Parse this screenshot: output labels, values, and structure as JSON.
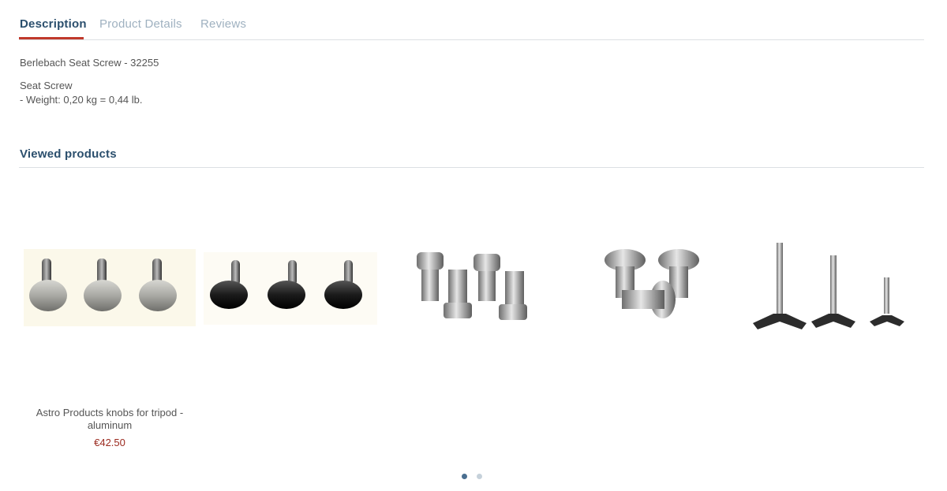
{
  "tabs": [
    {
      "label": "Description",
      "active": true
    },
    {
      "label": "Product Details",
      "active": false
    },
    {
      "label": "Reviews",
      "active": false
    }
  ],
  "description": {
    "title_line": "Berlebach Seat Screw - 32255",
    "line1": "Seat Screw",
    "line2": "- Weight: 0,20 kg = 0,44 lb."
  },
  "viewed": {
    "title": "Viewed products",
    "products": [
      {
        "name": "Astro Products knobs for tripod - aluminum",
        "price": "€42.50",
        "image": "aluminum-and-black-knob-screws"
      },
      {
        "image": "hex-socket-screws"
      },
      {
        "image": "button-head-screws"
      },
      {
        "image": "wing-knob-screws"
      }
    ],
    "pagination": {
      "pages": 2,
      "current": 1
    }
  },
  "colors": {
    "accent_underline": "#c0392b",
    "tab_active": "#2b4f6d",
    "tab_inactive": "#9fb1c0",
    "price": "#9b2a1f"
  }
}
